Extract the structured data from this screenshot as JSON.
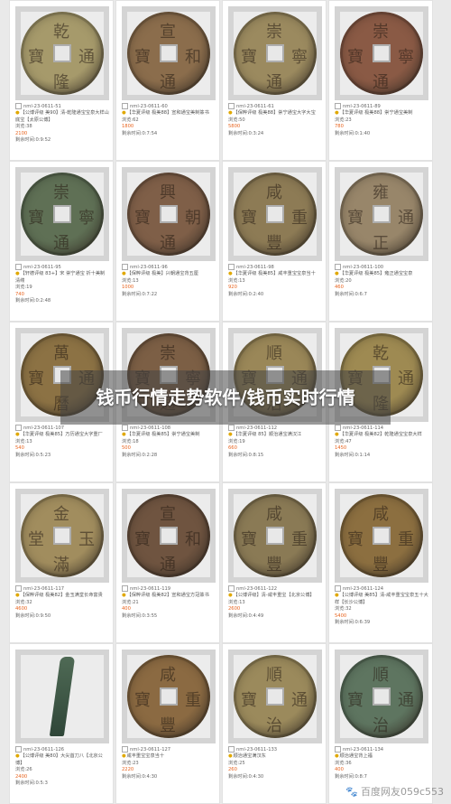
{
  "banner": {
    "title": "钱币行情走势软件/钱币实时行情"
  },
  "watermark": {
    "icon": "paw-icon",
    "text": "百度网友059c553"
  },
  "labels": {
    "views": "浏览:",
    "remaining": "剩余时间:"
  },
  "cards": [
    {
      "id": "nml-23-0611-51",
      "title": "【公博评级 美90】清-乾隆通宝宝泉大样山底宝【太原公博】",
      "views": "38",
      "price": "2100",
      "time": "0:9:52",
      "coin": "#a69a6b",
      "glyphs": [
        "乾",
        "通",
        "隆",
        "寶"
      ],
      "caption": "乾 通 隆 寶"
    },
    {
      "id": "nml-23-0611-60",
      "title": "【华夏评级 极美88】宣和通宝美制篆书",
      "views": "62",
      "price": "1800",
      "time": "0:7:54",
      "coin": "#8b6d4c",
      "glyphs": [
        "宣",
        "和",
        "通",
        "寶"
      ]
    },
    {
      "id": "nml-23-0611-61",
      "title": "【保粹评级 极美88】崇宁通宝大字大宝",
      "views": "50",
      "price": "5800",
      "time": "0:3:24",
      "coin": "#9b8a5f",
      "glyphs": [
        "崇",
        "寧",
        "通",
        "寶"
      ]
    },
    {
      "id": "nml-23-0611-89",
      "title": "【华夏评级 极美88】崇宁通宝美制",
      "views": "23",
      "price": "780",
      "time": "0:1:40",
      "coin": "#8a5a45",
      "glyphs": [
        "崇",
        "寧",
        "通",
        "寶"
      ]
    },
    {
      "id": "nml-23-0611-95",
      "title": "【轩德评级 83+】宋 崇宁通宝 折十美制清缕",
      "views": "19",
      "price": "740",
      "time": "0:2:48",
      "coin": "#5f7055",
      "glyphs": [
        "崇",
        "寧",
        "通",
        "寶"
      ]
    },
    {
      "id": "nml-23-0611-96",
      "title": "【保粹评级 极美】兴朝通宝背五厘",
      "views": "13",
      "price": "1000",
      "time": "0:7:22",
      "coin": "#7f5f48",
      "glyphs": [
        "興",
        "朝",
        "通",
        "寶"
      ]
    },
    {
      "id": "nml-23-0611-98",
      "title": "【华夏评级 极美85】咸丰重宝宝泉当十",
      "views": "13",
      "price": "920",
      "time": "0:2:40",
      "coin": "#8d7b55",
      "glyphs": [
        "咸",
        "重",
        "豐",
        "寶"
      ]
    },
    {
      "id": "nml-23-0611-100",
      "title": "【华夏评级 极美85】雍正通宝宝泉",
      "views": "20",
      "price": "460",
      "time": "0:6:7",
      "coin": "#98866a",
      "glyphs": [
        "雍",
        "通",
        "正",
        "寶"
      ]
    },
    {
      "id": "nml-23-0611-107",
      "title": "【华夏评级 极美85】万历通宝大字重厂",
      "views": "13",
      "price": "540",
      "time": "0:5:23",
      "coin": "#8c7244",
      "glyphs": [
        "萬",
        "通",
        "曆",
        "寶"
      ]
    },
    {
      "id": "nml-23-0611-108",
      "title": "【华夏评级 极美85】崇宁通宝美制",
      "views": "18",
      "price": "500",
      "time": "0:2:28",
      "coin": "#7c5f45",
      "glyphs": [
        "崇",
        "寧",
        "通",
        "寶"
      ]
    },
    {
      "id": "nml-23-0611-112",
      "title": "【华夏评级 85】顺治通宝满汉江",
      "views": "19",
      "price": "660",
      "time": "0:8:15",
      "coin": "#9a8758",
      "glyphs": [
        "順",
        "通",
        "治",
        "寶"
      ]
    },
    {
      "id": "nml-23-0611-114",
      "title": "【华夏评级 极美82】乾隆通宝宝泉大样",
      "views": "47",
      "price": "1450",
      "time": "0:1:14",
      "coin": "#9e8a52",
      "glyphs": [
        "乾",
        "通",
        "隆",
        "寶"
      ]
    },
    {
      "id": "nml-23-0611-117",
      "title": "【保粹评级 极美82】金玉满堂长命富贵",
      "views": "32",
      "price": "4600",
      "time": "0:9:50",
      "coin": "#a18d5e",
      "glyphs": [
        "金",
        "玉",
        "滿",
        "堂"
      ]
    },
    {
      "id": "nml-23-0611-119",
      "title": "【保粹评级 极美82】宣和通宝方冠篆书",
      "views": "21",
      "price": "400",
      "time": "0:3:55",
      "coin": "#6f5440",
      "glyphs": [
        "宣",
        "和",
        "通",
        "寶"
      ]
    },
    {
      "id": "nml-23-0611-122",
      "title": "【公博评级】清-咸丰重宝【北京公博】",
      "views": "13",
      "price": "2600",
      "time": "0:4:49",
      "coin": "#8a7a55",
      "glyphs": [
        "咸",
        "重",
        "豐",
        "寶"
      ]
    },
    {
      "id": "nml-23-0611-124",
      "title": "【公博评级 美85】清-咸丰重宝宝泉五十大样【长沙公博】",
      "views": "32",
      "price": "5400",
      "time": "0:6:39",
      "coin": "#8c6f40",
      "glyphs": [
        "咸",
        "重",
        "豐",
        "寶"
      ]
    },
    {
      "id": "nml-23-0611-126",
      "title": "【公博评级 美80】大尖首刀八【北京公博】",
      "views": "26",
      "price": "2400",
      "time": "0:5:3",
      "coin": "#4f6a55",
      "glyphs": []
    },
    {
      "id": "nml-23-0611-127",
      "title": "咸丰重宝宝泉当十",
      "views": "23",
      "price": "2220",
      "time": "0:4:30",
      "coin": "#8b6a42",
      "glyphs": [
        "咸",
        "重",
        "豐",
        "寶"
      ]
    },
    {
      "id": "nml-23-0611-133",
      "title": "顺治通宝满汉东",
      "views": "25",
      "price": "260",
      "time": "0:4:30",
      "coin": "#9b8a5c",
      "glyphs": [
        "順",
        "通",
        "治",
        "寶"
      ]
    },
    {
      "id": "nml-23-0611-134",
      "title": "顺治通宝背上福",
      "views": "36",
      "price": "400",
      "time": "0:8:7",
      "coin": "#5e7560",
      "glyphs": [
        "順",
        "通",
        "治",
        "寶"
      ]
    }
  ]
}
